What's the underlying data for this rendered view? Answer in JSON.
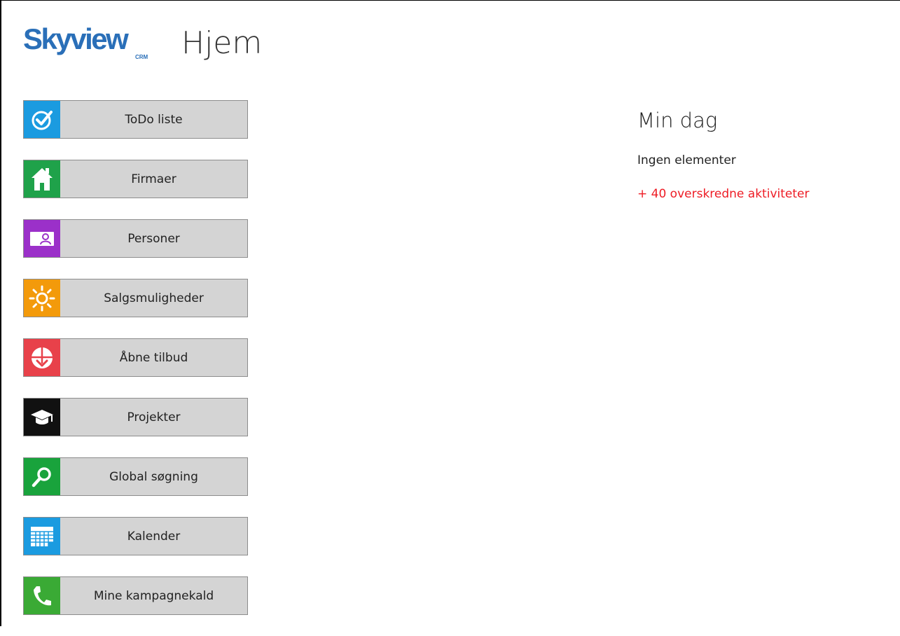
{
  "header": {
    "logo_text": "Skyview",
    "logo_sub": "CRM",
    "title": "Hjem"
  },
  "nav": {
    "items": [
      {
        "label": "ToDo liste",
        "icon": "check-icon",
        "color": "#1b9be0"
      },
      {
        "label": "Firmaer",
        "icon": "house-icon",
        "color": "#1fa24a"
      },
      {
        "label": "Personer",
        "icon": "contact-card-icon",
        "color": "#9b30c9"
      },
      {
        "label": "Salgsmuligheder",
        "icon": "sun-icon",
        "color": "#f39a0b"
      },
      {
        "label": "Åbne tilbud",
        "icon": "offer-icon",
        "color": "#e8414a"
      },
      {
        "label": "Projekter",
        "icon": "graduation-cap-icon",
        "color": "#111111"
      },
      {
        "label": "Global søgning",
        "icon": "search-icon",
        "color": "#19a33c"
      },
      {
        "label": "Kalender",
        "icon": "calendar-icon",
        "color": "#1b9be0"
      },
      {
        "label": "Mine kampagnekald",
        "icon": "phone-icon",
        "color": "#3aaa35"
      }
    ]
  },
  "min_dag": {
    "title": "Min dag",
    "empty_text": "Ingen elementer",
    "overdue_link": "+ 40 overskredne aktiviteter"
  }
}
